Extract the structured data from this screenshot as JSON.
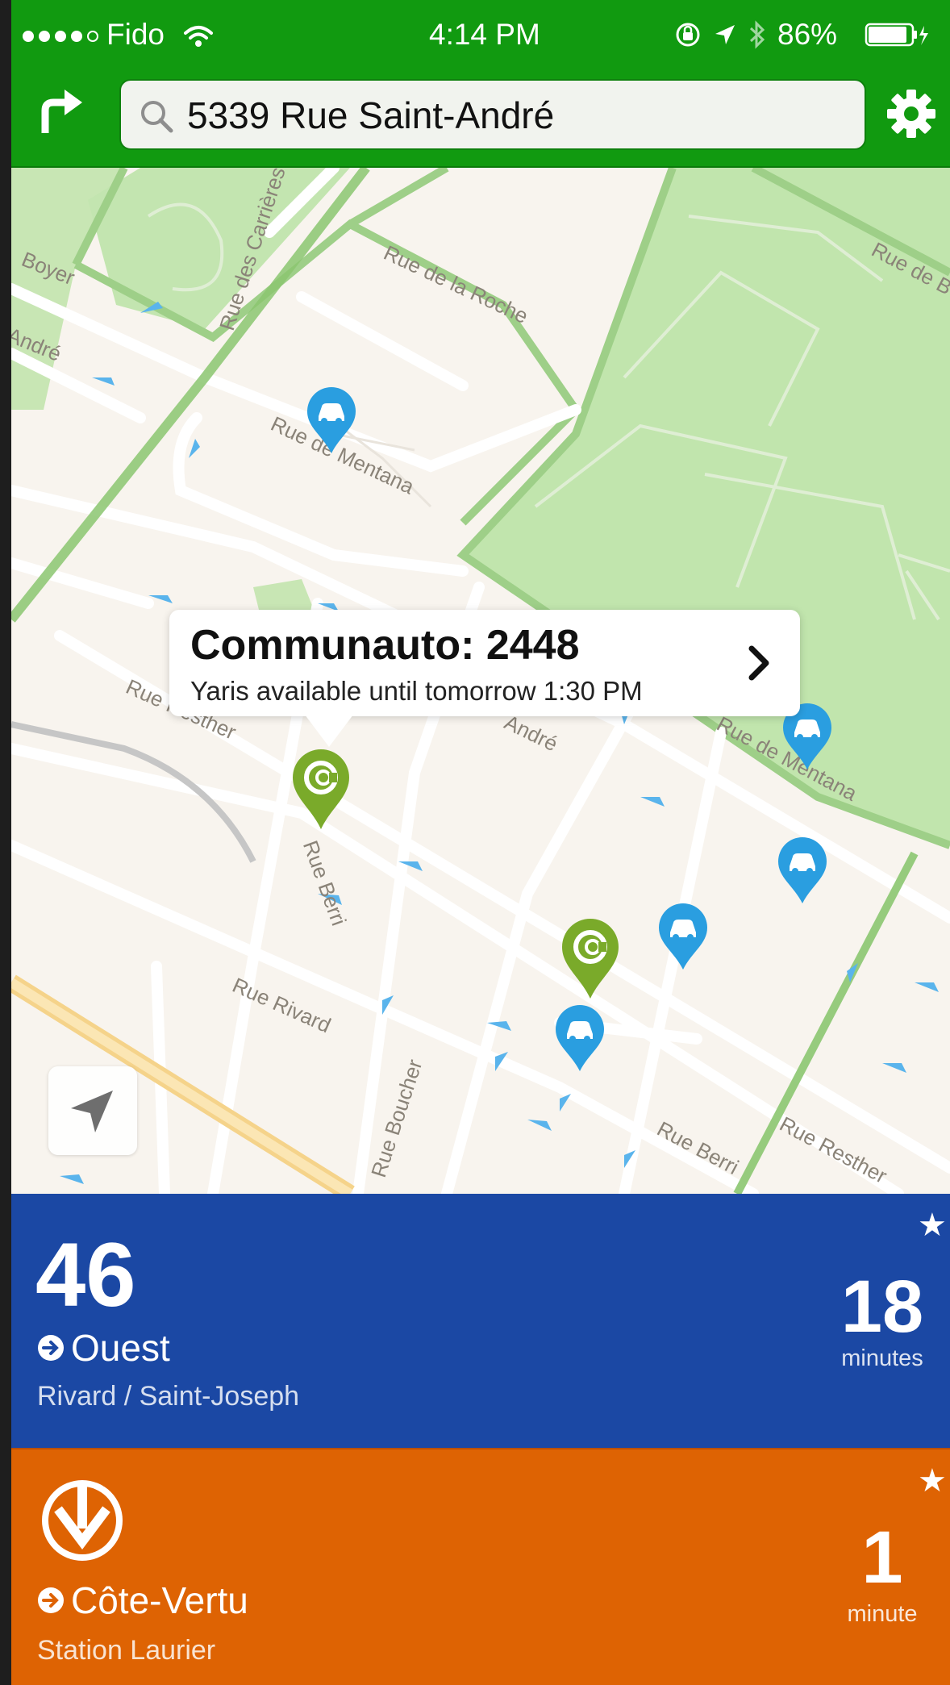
{
  "status_bar": {
    "carrier": "Fido",
    "time": "4:14 PM",
    "battery": "86%"
  },
  "search": {
    "value": "5339 Rue Saint-André"
  },
  "map": {
    "street_labels": {
      "boyer": "Boyer",
      "andre_left": "André",
      "des_carrieres": "Rue des Carrières",
      "de_la_roche": "Rue de la Roche",
      "mentana_top": "Rue de Mentana",
      "resther_left": "Rue Resther",
      "andre_mid": "André",
      "mentana_right": "Rue de Mentana",
      "berri_top": "Rue Berri",
      "rivard": "Rue Rivard",
      "boucher": "Rue Boucher",
      "berri_bottom": "Rue Berri",
      "resther_right": "Rue Resther",
      "de_b": "Rue de B"
    },
    "callout": {
      "title": "Communauto: 2448",
      "subtitle": "Yaris available until tomorrow 1:30 PM"
    },
    "colors": {
      "car_pin": "#2a9ee0",
      "communauto_pin": "#7aaa2a"
    }
  },
  "bus_card": {
    "route": "46",
    "direction": "Ouest",
    "stop": "Rivard / Saint-Joseph",
    "time": "18",
    "unit": "minutes",
    "color": "#1b48a4"
  },
  "metro_card": {
    "direction": "Côte-Vertu",
    "stop": "Station Laurier",
    "time": "1",
    "unit": "minute",
    "color": "#de6303"
  }
}
